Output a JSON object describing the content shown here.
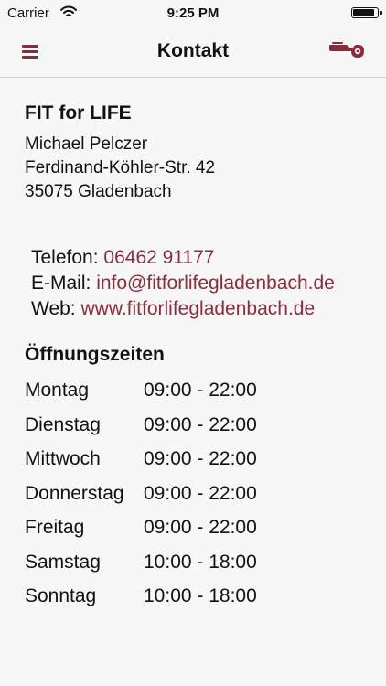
{
  "status_bar": {
    "carrier": "Carrier",
    "time": "9:25 PM",
    "battery_level": 0.9
  },
  "nav": {
    "title": "Kontakt",
    "menu_icon": "hamburger-menu-icon",
    "right_icon": "whistle-icon"
  },
  "contact": {
    "business_name": "FIT for LIFE",
    "person": "Michael Pelczer",
    "street": "Ferdinand-Köhler-Str. 42",
    "city": "35075 Gladenbach",
    "phone_label": "Telefon:",
    "phone": "06462 91177",
    "email_label": "E-Mail:",
    "email": "info@fitforlifegladenbach.de",
    "web_label": "Web:",
    "web": "www.fitforlifegladenbach.de"
  },
  "hours": {
    "title": "Öffnungszeiten",
    "rows": [
      {
        "day": "Montag",
        "time": "09:00 - 22:00"
      },
      {
        "day": "Dienstag",
        "time": "09:00 - 22:00"
      },
      {
        "day": "Mittwoch",
        "time": "09:00 - 22:00"
      },
      {
        "day": "Donnerstag",
        "time": "09:00 - 22:00"
      },
      {
        "day": "Freitag",
        "time": "09:00 - 22:00"
      },
      {
        "day": "Samstag",
        "time": "10:00 - 18:00"
      },
      {
        "day": "Sonntag",
        "time": "10:00 - 18:00"
      }
    ]
  },
  "colors": {
    "accent": "#8b2b3e",
    "background": "#f7f7f7",
    "text": "#111111",
    "divider": "#d2d2d2"
  }
}
